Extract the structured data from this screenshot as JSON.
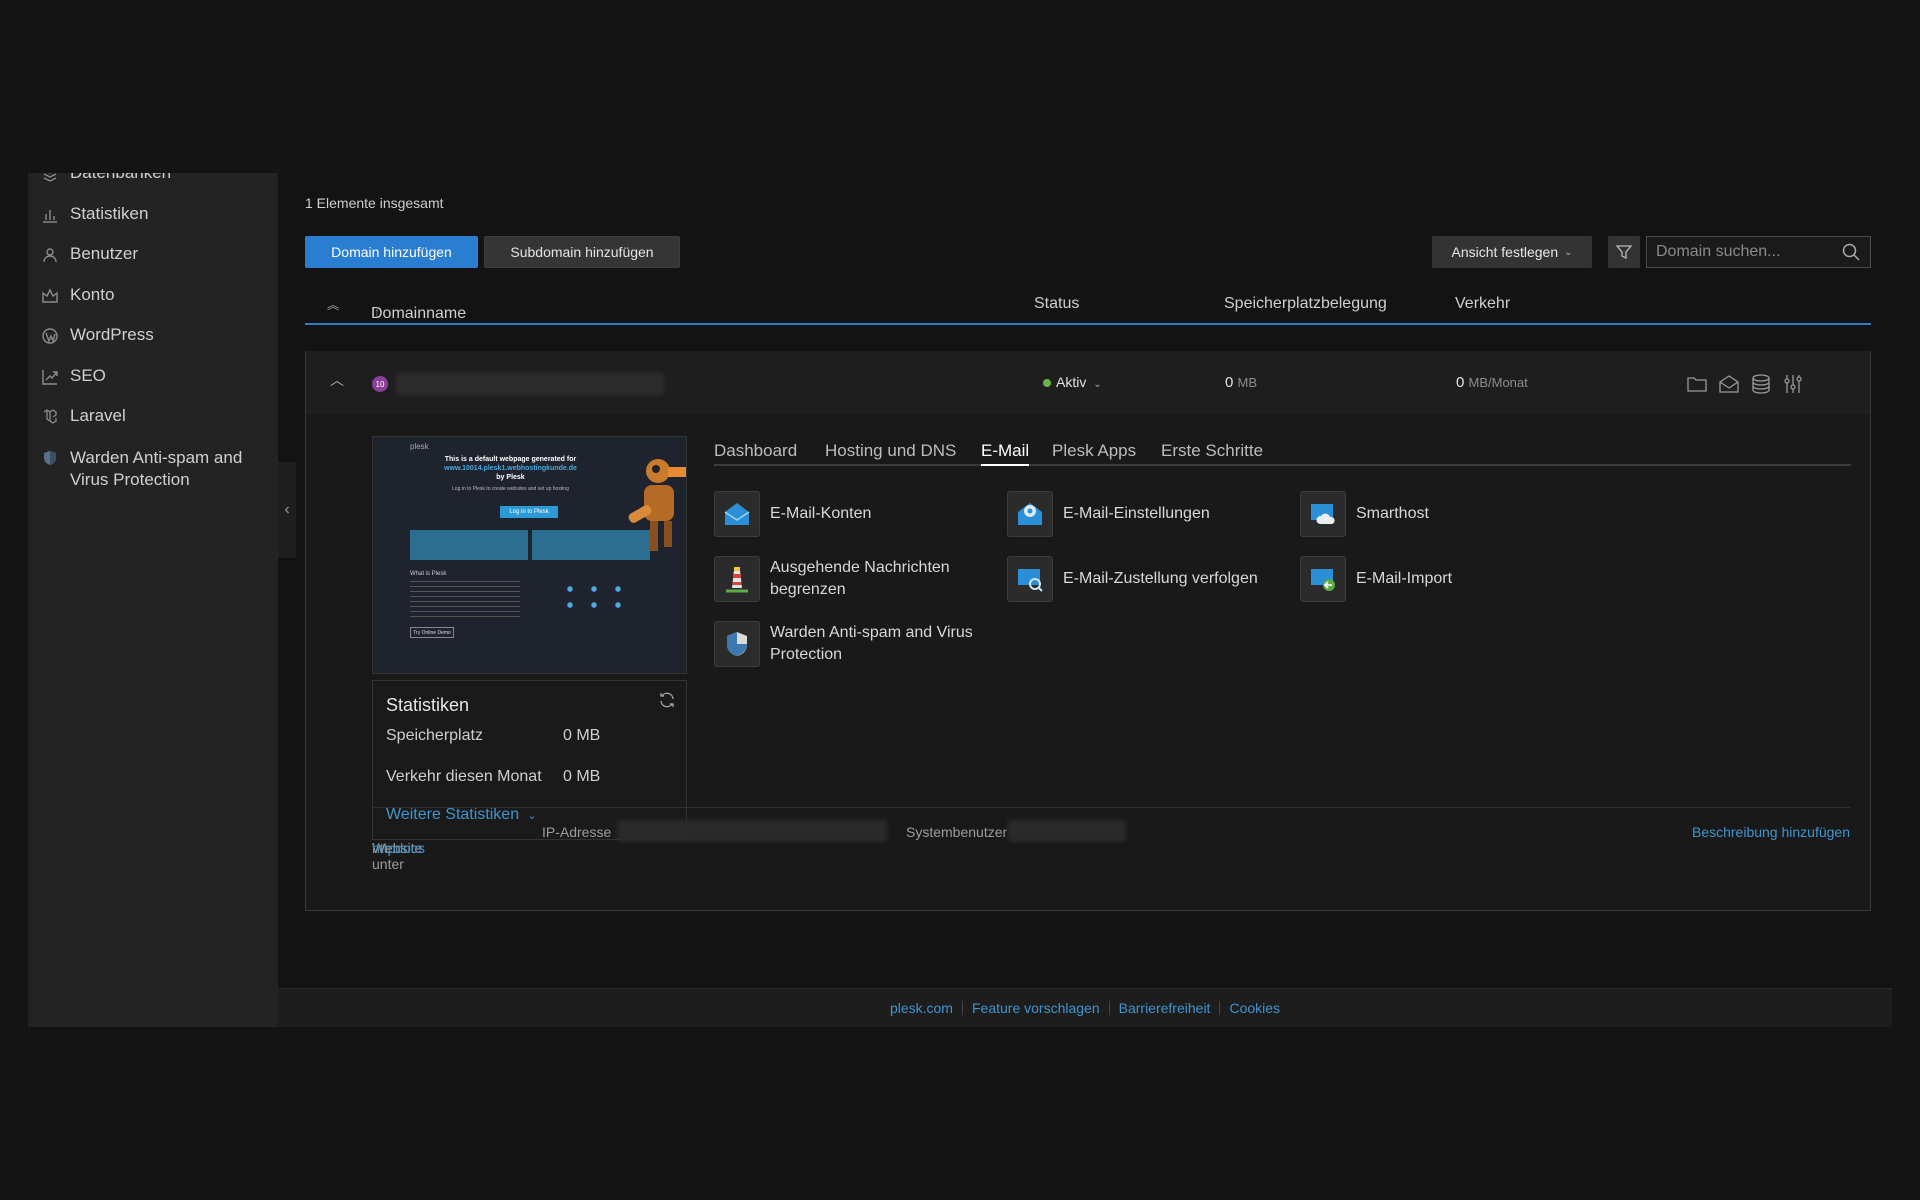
{
  "sidebar": {
    "items": [
      {
        "label": "Datenbanken",
        "icon": "database-icon"
      },
      {
        "label": "Statistiken",
        "icon": "bar-chart-icon"
      },
      {
        "label": "Benutzer",
        "icon": "user-icon"
      },
      {
        "label": "Konto",
        "icon": "crown-icon"
      },
      {
        "label": "WordPress",
        "icon": "wordpress-icon"
      },
      {
        "label": "SEO",
        "icon": "trend-chart-icon"
      },
      {
        "label": "Laravel",
        "icon": "laravel-icon"
      },
      {
        "label": "Warden Anti-spam and Virus Protection",
        "icon": "shield-icon"
      }
    ]
  },
  "list": {
    "count_text": "1 Elemente insgesamt",
    "add_domain": "Domain hinzufügen",
    "add_subdomain": "Subdomain hinzufügen",
    "view_button": "Ansicht festlegen",
    "search_placeholder": "Domain suchen..."
  },
  "table": {
    "headers": {
      "domain": "Domainname",
      "status": "Status",
      "storage": "Speicherplatzbelegung",
      "traffic": "Verkehr"
    }
  },
  "domain_row": {
    "badge": "10",
    "status": "Aktiv",
    "storage_value": "0",
    "storage_unit": "MB",
    "traffic_value": "0",
    "traffic_unit": "MB/Monat"
  },
  "preview": {
    "brand": "plesk",
    "heading": "This is a default webpage generated for",
    "domain": "www.10014.plesk1.webhostingkunde.de",
    "by": "by Plesk",
    "sub": "Log in to Plesk to create websites and set up hosting",
    "button": "Log in to Plesk",
    "what_is": "What is Plesk",
    "demo": "Try Online Demo"
  },
  "stats": {
    "title": "Statistiken",
    "storage_label": "Speicherplatz",
    "storage_value": "0 MB",
    "traffic_label": "Verkehr diesen Monat",
    "traffic_value": "0 MB",
    "more": "Weitere Statistiken"
  },
  "tabs": [
    "Dashboard",
    "Hosting und DNS",
    "E-Mail",
    "Plesk Apps",
    "Erste Schritte"
  ],
  "active_tab": "E-Mail",
  "tools": [
    {
      "label": "E-Mail-Konten",
      "icon": "mail-accounts-icon"
    },
    {
      "label": "E-Mail-Einstellungen",
      "icon": "mail-settings-icon"
    },
    {
      "label": "Smarthost",
      "icon": "smarthost-cloud-icon"
    },
    {
      "label": "Ausgehende Nachrichten begrenzen",
      "icon": "lighthouse-icon"
    },
    {
      "label": "E-Mail-Zustellung verfolgen",
      "icon": "mail-tracking-icon"
    },
    {
      "label": "E-Mail-Import",
      "icon": "mail-import-icon"
    },
    {
      "label": "Warden Anti-spam and Virus Protection",
      "icon": "warden-shield-icon"
    }
  ],
  "panel_footer": {
    "website_under": "Website unter",
    "httpdocs": "httpdocs",
    "ip_label": "IP-Adresse",
    "sysuser_label": "Systembenutzer",
    "add_description": "Beschreibung hinzufügen"
  },
  "footer": {
    "links": [
      "plesk.com",
      "Feature vorschlagen",
      "Barrierefreiheit",
      "Cookies"
    ]
  },
  "colors": {
    "primary": "#2a7ed2",
    "link": "#3f95cf",
    "active_dot": "#6bb34a",
    "badge": "#8a3f99"
  }
}
